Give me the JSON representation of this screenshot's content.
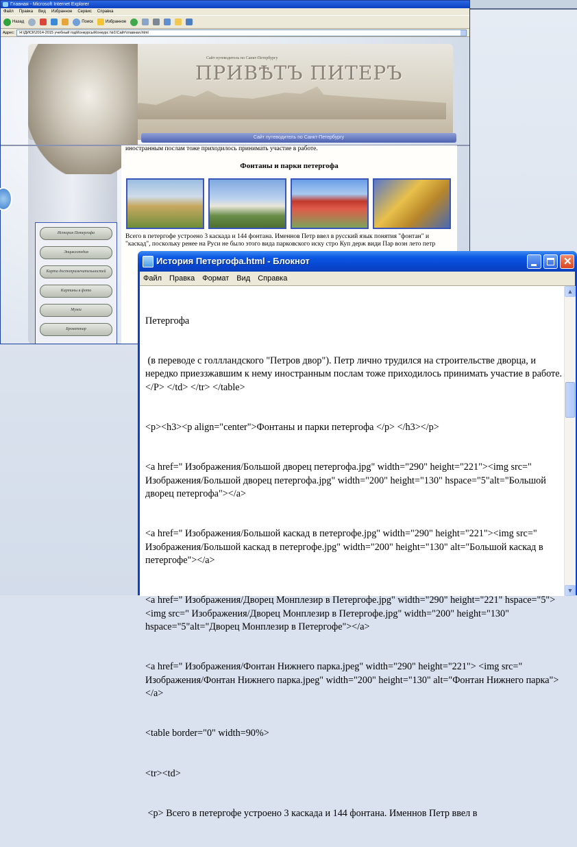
{
  "browser": {
    "title": "Главная - Microsoft Internet Explorer",
    "menu": [
      "Файл",
      "Правка",
      "Вид",
      "Избранное",
      "Сервис",
      "Справка"
    ],
    "toolbar": {
      "back": "Назад",
      "search": "Поиск",
      "favorites": "Избранное"
    },
    "address_label": "Адрес:",
    "address": "H:\\ДИСК\\2014-2015 учебный год\\Конкурсы\\Конкурс №1\\Сайт\\главная.html"
  },
  "site": {
    "subtitle": "Сайт путеводитель по Санкт-Петербургу",
    "title": "ПРИВѢТЪ  ПИТЕРЪ",
    "banner": "Сайт путеводитель по Санкт-Петербургу",
    "top_text": "иностранным послам тоже приходилось принимать участие в работе.",
    "heading": "Фонтаны и парки петергофа",
    "paragraph": "Всего в петергофе устроено 3 каскада и 144 фонтана. Именнов Петр ввел в русский язык понятия \"фонтан\" и \"каскад\", поскольку ренее на Руси не было этого вида парковского иску стро Куп держ види Пар возн лето петр",
    "nav": [
      "История Петергофа",
      "Энциклопедия",
      "Карта достопримечательностей",
      "Картины в фото",
      "Музеи",
      "Бронеттар"
    ]
  },
  "notepad": {
    "title": "История Петергофа.html - Блокнот",
    "menu": [
      "Файл",
      "Правка",
      "Формат",
      "Вид",
      "Справка"
    ],
    "lines": [
      "Петергофа",
      " (в переводе с голлландского \"Петров двор\"). Петр лично трудился на строительстве дворца, и нередко приеззжавшим к нему иностранным послам тоже приходилось принимать участие в работе.</P> </td> </tr> </table>",
      "<p><h3><p align=\"center\">Фонтаны и парки петергофа </p> </h3></p>",
      "<a href=\" Изображения/Большой дворец петергофа.jpg\" width=\"290\" height=\"221\"><img src=\" Изображения/Большой дворец петергофа.jpg\" width=\"200\" height=\"130\" hspace=\"5\"alt=\"Большой дворец петергофа\"></a>",
      "<a href=\" Изображения/Большой каскад в петергофе.jpg\" width=\"290\" height=\"221\"><img src=\" Изображения/Большой каскад в петергофе.jpg\" width=\"200\" height=\"130\" alt=\"Большой каскад в петергофе\"></a>",
      "<a href=\" Изображения/Дворец Монплезир в Петергофе.jpg\" width=\"290\" height=\"221\" hspace=\"5\"> <img src=\" Изображения/Дворец Монплезир в Петергофе.jpg\" width=\"200\" height=\"130\" hspace=\"5\"alt=\"Дворец Монплезир в Петергофе\"></a>",
      "<a href=\" Изображения/Фонтан Нижнего парка.jpeg\" width=\"290\" height=\"221\"> <img src=\" Изображения/Фонтан Нижнего парка.jpeg\" width=\"200\" height=\"130\" alt=\"Фонтан Нижнего парка\"></a>",
      "<table border=\"0\" width=90%>",
      "<tr><td>",
      " <p> Всего в петергофе устроено 3 каскада и 144 фонтана. Именнов Петр ввел в"
    ]
  }
}
